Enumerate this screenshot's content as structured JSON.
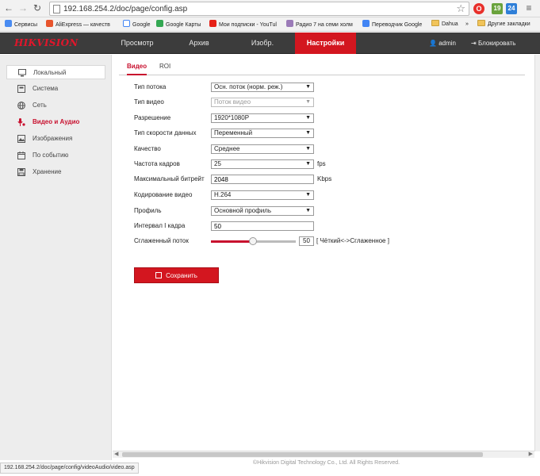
{
  "browser": {
    "url": "192.168.254.2/doc/page/config.asp",
    "status_url": "192.168.254.2/doc/page/config/videoAudio/video.asp",
    "bookmarks": [
      {
        "label": "Сервисы",
        "color": "#4a8cf2"
      },
      {
        "label": "AliExpress — качеств",
        "color": "#e8552d"
      },
      {
        "label": "Google",
        "color": "#4285f4"
      },
      {
        "label": "Google Карты",
        "color": "#34a853"
      },
      {
        "label": "Мои подписки - YouTul",
        "color": "#e62117"
      },
      {
        "label": "Радио 7 на семи холм",
        "color": "#9b7bb8"
      },
      {
        "label": "Переводчик Google",
        "color": "#4285f4"
      },
      {
        "label": "Dahua",
        "color": "folder"
      },
      {
        "label": "»",
        "color": "none"
      },
      {
        "label": "Другие закладки",
        "color": "folder"
      }
    ],
    "ext_badge": "24",
    "ext_badge2": "19"
  },
  "app": {
    "logo_main": "HIK",
    "logo_rest": "VISION",
    "tabs": [
      "Просмотр",
      "Архив",
      "Изобр.",
      "Настройки"
    ],
    "active_tab": "Настройки",
    "user": "admin",
    "logout": "Блокировать"
  },
  "sidebar": {
    "items": [
      {
        "label": "Локальный",
        "icon": "monitor-icon"
      },
      {
        "label": "Система",
        "icon": "system-icon"
      },
      {
        "label": "Сеть",
        "icon": "network-globe-icon"
      },
      {
        "label": "Видео и Аудио",
        "icon": "video-audio-icon"
      },
      {
        "label": "Изображения",
        "icon": "image-icon"
      },
      {
        "label": "По событию",
        "icon": "event-calendar-icon"
      },
      {
        "label": "Хранение",
        "icon": "storage-icon"
      }
    ]
  },
  "subtabs": [
    "Видео",
    "ROI"
  ],
  "form": {
    "stream_type": {
      "label": "Тип потока",
      "value": "Осн. поток (норм. реж.)"
    },
    "video_type": {
      "label": "Тип видео",
      "value": "Поток видео"
    },
    "resolution": {
      "label": "Разрешение",
      "value": "1920*1080P"
    },
    "bitrate_type": {
      "label": "Тип скорости данных",
      "value": "Переменный"
    },
    "quality": {
      "label": "Качество",
      "value": "Среднее"
    },
    "frame_rate": {
      "label": "Частота кадров",
      "value": "25",
      "unit": "fps"
    },
    "max_bitrate": {
      "label": "Максимальный битрейт",
      "value": "2048",
      "unit": "Kbps"
    },
    "encoding": {
      "label": "Кодирование видео",
      "value": "H.264"
    },
    "profile": {
      "label": "Профиль",
      "value": "Основной профиль"
    },
    "i_frame": {
      "label": "Интервал I кадра",
      "value": "50"
    },
    "smoothing": {
      "label": "Сглаженный поток",
      "value": "50",
      "hint": "[ Чёткий<->Сглаженное ]"
    }
  },
  "save_label": "Сохранить",
  "footer": "©Hikvision Digital Technology Co., Ltd. All Rights Reserved."
}
